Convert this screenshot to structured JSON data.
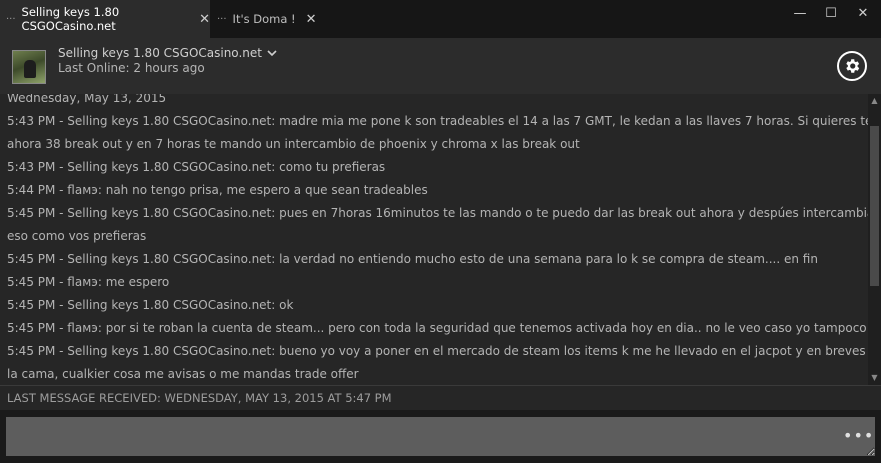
{
  "tabs": [
    {
      "label": "Selling keys 1.80 CSGOCasino.net",
      "close": "✕",
      "menu": "···"
    },
    {
      "label": "It's Doma !",
      "close": "✕",
      "menu": "···"
    }
  ],
  "window_controls": {
    "minimize": "—",
    "maximize": "☐",
    "close": "✕"
  },
  "header": {
    "name": "Selling keys 1.80 CSGOCasino.net",
    "status": "Last Online: 2 hours ago",
    "dropdown_icon": "chevron-down-icon",
    "settings_icon": "gear-icon"
  },
  "chat": {
    "lines": [
      "Wednesday, May 13, 2015",
      "5:43 PM - Selling keys 1.80 CSGOCasino.net: madre mia me pone k son tradeables el 14 a las 7 GMT, le kedan a las llaves 7 horas. Si quieres te doy",
      "ahora 38 break out y en 7 horas te mando un intercambio de phoenix y chroma x las break out",
      "5:43 PM - Selling keys 1.80 CSGOCasino.net: como tu prefieras",
      "5:44 PM - flaмэ: nah no tengo prisa, me espero a que sean tradeables",
      "5:45 PM - Selling keys 1.80 CSGOCasino.net: pues en 7horas 16minutos te las mando o te puedo dar las break out ahora y despúes intercambiar",
      "eso como vos prefieras",
      "5:45 PM - Selling keys 1.80 CSGOCasino.net: la verdad no entiendo mucho esto de una semana para lo k se compra de steam.... en fin",
      "5:45 PM - flaмэ: me espero",
      "5:45 PM - Selling keys 1.80 CSGOCasino.net: ok",
      "5:45 PM - flaмэ: por si te roban la cuenta de steam... pero con toda la seguridad que tenemos activada hoy en dia.. no le veo caso yo tampoco",
      "5:45 PM - Selling keys 1.80 CSGOCasino.net: bueno yo voy a poner en el mercado de steam los items k me he llevado en el jacpot y en breves ire a",
      "la cama, cualkier cosa me avisas o me mandas trade offer"
    ]
  },
  "footer": {
    "last_message": "LAST MESSAGE RECEIVED: WEDNESDAY, MAY 13, 2015 AT 5:47 PM",
    "input_value": "",
    "more_label": "•••"
  }
}
